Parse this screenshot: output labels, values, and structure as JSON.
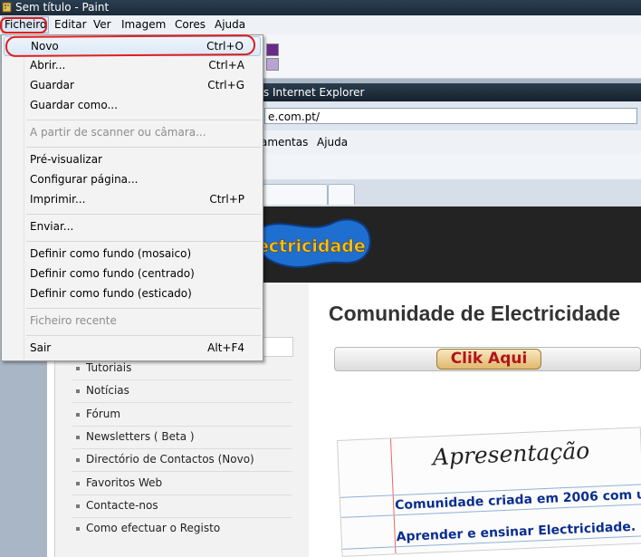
{
  "window": {
    "title": "Sem título - Paint"
  },
  "menubar": {
    "items": [
      "Ficheiro",
      "Editar",
      "Ver",
      "Imagem",
      "Cores",
      "Ajuda"
    ]
  },
  "file_menu": {
    "items": [
      {
        "label": "Novo",
        "shortcut": "Ctrl+O"
      },
      {
        "label": "Abrir...",
        "shortcut": "Ctrl+A"
      },
      {
        "label": "Guardar",
        "shortcut": "Ctrl+G"
      },
      {
        "label": "Guardar como...",
        "shortcut": ""
      },
      {
        "label": "A partir de scanner ou câmara...",
        "shortcut": ""
      },
      {
        "label": "Pré-visualizar",
        "shortcut": ""
      },
      {
        "label": "Configurar página...",
        "shortcut": ""
      },
      {
        "label": "Imprimir...",
        "shortcut": "Ctrl+P"
      },
      {
        "label": "Enviar...",
        "shortcut": ""
      },
      {
        "label": "Definir como fundo (mosaico)",
        "shortcut": ""
      },
      {
        "label": "Definir como fundo (centrado)",
        "shortcut": ""
      },
      {
        "label": "Definir como fundo (esticado)",
        "shortcut": ""
      },
      {
        "label": "Ficheiro recente",
        "shortcut": ""
      },
      {
        "label": "Sair",
        "shortcut": "Alt+F4"
      }
    ]
  },
  "colors": {
    "swatch_dark": "#6a2a8c",
    "swatch_light": "#b9a3d6",
    "highlight": "#e02020"
  },
  "browser": {
    "title_fragment": "rs Internet Explorer",
    "address_fragment": "e.com.pt/",
    "menu": [
      "amentas",
      "Ajuda"
    ]
  },
  "site": {
    "logo_text": "ectricidade",
    "heading": "Comunidade de Electricidade",
    "clik_button": "Clik Aqui",
    "nav": [
      "Tutoriais",
      "Notícias",
      "Fórum",
      "Newsletters ( Beta )",
      "Directório de Contactos (Novo)",
      "Favoritos Web",
      "Contacte-nos",
      "Como efectuar o Registo"
    ],
    "paper_title": "Apresentação",
    "paper_line1": "Comunidade criada em 2006 com u",
    "paper_line2": "Aprender e ensinar Electricidade."
  }
}
